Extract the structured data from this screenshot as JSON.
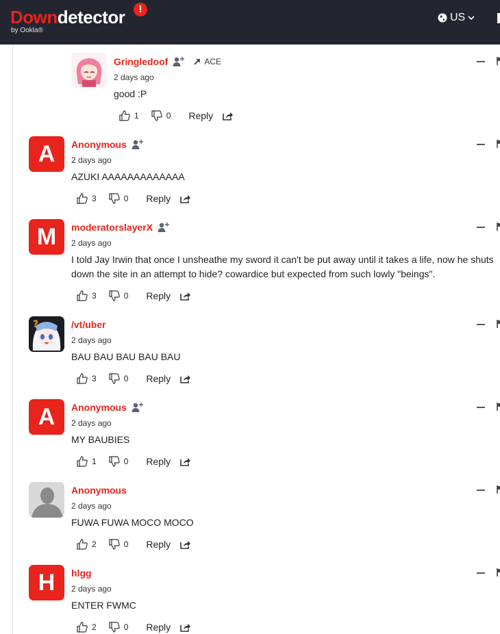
{
  "header": {
    "logo_down": "Down",
    "logo_detector": "detector",
    "logo_badge": "!",
    "logo_sub": "by Ookla®",
    "region_label": "US",
    "region_icon": "globe-icon",
    "background": "#232530",
    "brand_color": "#e8241c"
  },
  "comments": [
    {
      "author": "Gringledoof",
      "badge": "ACE",
      "time": "2 days ago",
      "text": "good :P",
      "likes": "1",
      "dislikes": "0",
      "reply": "Reply",
      "avatar": "anime-girl-pink"
    },
    {
      "author": "Anonymous",
      "time": "2 days ago",
      "text": "AZUKI AAAAAAAAAAAAA",
      "likes": "3",
      "dislikes": "0",
      "reply": "Reply",
      "avatar_letter": "A"
    },
    {
      "author": "moderatorslayerX",
      "time": "2 days ago",
      "text": "I told Jay Irwin that once I unsheathe my sword it can't be put away until it takes a life, now he shuts down the site in an attempt to hide? cowardice but expected from such lowly \"beings\".",
      "likes": "3",
      "dislikes": "0",
      "reply": "Reply",
      "avatar_letter": "M"
    },
    {
      "author": "/vt/uber",
      "time": "2 days ago",
      "text": "BAU BAU BAU BAU BAU",
      "likes": "3",
      "dislikes": "0",
      "reply": "Reply",
      "avatar": "anime-shark-girl"
    },
    {
      "author": "Anonymous",
      "time": "2 days ago",
      "text": "MY BAUBIES",
      "likes": "1",
      "dislikes": "0",
      "reply": "Reply",
      "avatar_letter": "A"
    },
    {
      "author": "Anonymous",
      "time": "2 days ago",
      "text": "FUWA FUWA MOCO MOCO",
      "likes": "2",
      "dislikes": "0",
      "reply": "Reply",
      "avatar": "default-silhouette"
    },
    {
      "author": "hlgg",
      "time": "2 days ago",
      "text": "ENTER FWMC",
      "likes": "2",
      "dislikes": "0",
      "reply": "Reply",
      "avatar_letter": "H"
    }
  ]
}
